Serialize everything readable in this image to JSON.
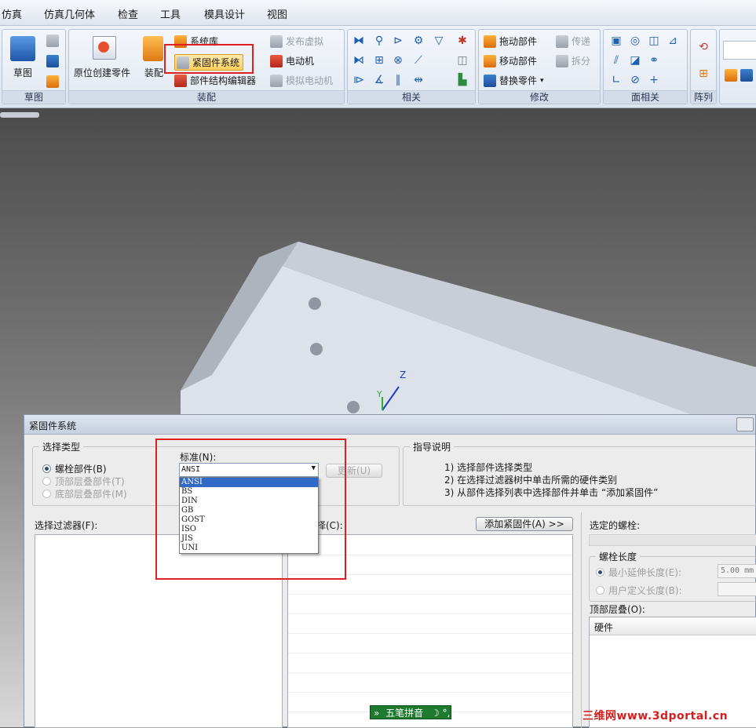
{
  "menu": [
    "仿真",
    "仿真几何体",
    "检查",
    "工具",
    "模具设计",
    "视图"
  ],
  "ribbon": {
    "groups": [
      {
        "label": "草图"
      },
      {
        "label": "装配"
      },
      {
        "label": "相关"
      },
      {
        "label": "修改"
      },
      {
        "label": "面相关"
      },
      {
        "label": "阵列"
      }
    ],
    "sketch_label": "草图",
    "create_inplace_label": "原位创建零件",
    "assemble_label": "装配",
    "system_library_label": "系统库",
    "fastener_system_label": "紧固件系统",
    "structure_editor_label": "部件结构编辑器",
    "publish_virtual_label": "发布虚拟",
    "motor_label": "电动机",
    "simulate_motor_label": "模拟电动机",
    "drag_part_label": "拖动部件",
    "move_part_label": "移动部件",
    "replace_part_label": "替换零件",
    "transfer_label": "传递",
    "split_label": "拆分"
  },
  "dialog": {
    "title": "紧固件系统",
    "select_type": {
      "legend": "选择类型",
      "options": [
        {
          "label": "螺栓部件(B)",
          "checked": true,
          "enabled": true
        },
        {
          "label": "顶部层叠部件(T)",
          "checked": false,
          "enabled": false
        },
        {
          "label": "底部层叠部件(M)",
          "checked": false,
          "enabled": false
        }
      ]
    },
    "standard": {
      "label": "标准(N):",
      "value": "ANSI",
      "options": [
        "ANSI",
        "BS",
        "DIN",
        "GB",
        "GOST",
        "ISO",
        "JIS",
        "UNI"
      ],
      "update_button": "更新(U)"
    },
    "guide": {
      "legend": "指导说明",
      "lines": [
        "1) 选择部件选择类型",
        "2) 在选择过滤器树中单击所需的硬件类别",
        "3) 从部件选择列表中选择部件并单击 “添加紧固件”"
      ]
    },
    "filter_label": "选择过滤器(F):",
    "selection_label": "择(C):",
    "add_fastener_button": "添加紧固件(A) >>",
    "selected_bolt_label": "选定的螺栓:",
    "bolt_length": {
      "legend": "螺栓长度",
      "min_extend_label": "最小延伸长度(E):",
      "min_extend_value": "5.00 mm",
      "user_defined_label": "用户定义长度(B):"
    },
    "top_stack_label": "顶部层叠(O):",
    "top_stack_column": "硬件"
  },
  "axis": {
    "z": "Z",
    "y": "Y"
  },
  "ime": {
    "label": "五笔拼音"
  },
  "watermark": "三维网www.3dportal.cn",
  "colors": {
    "highlight": "#e02020",
    "selection": "#3169c6",
    "ime_bg": "#1e7a2e"
  }
}
